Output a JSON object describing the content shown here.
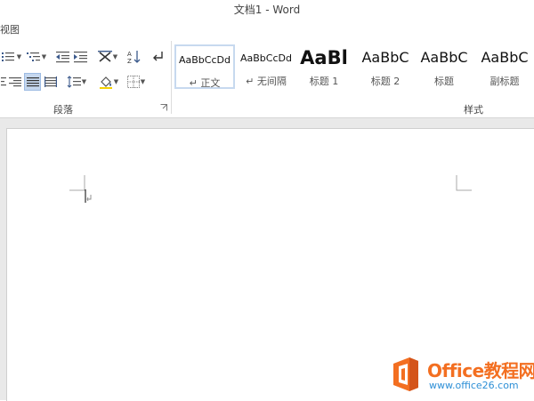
{
  "window": {
    "title": "文档1 - Word"
  },
  "tabs": {
    "view_partial": "视图"
  },
  "ribbon": {
    "paragraph_group_label": "段落",
    "styles_group_label": "样式",
    "styles": [
      {
        "preview": "AaBbCcDd",
        "name": "↵ 正文",
        "selected": true
      },
      {
        "preview": "AaBbCcDd",
        "name": "↵ 无间隔",
        "selected": false
      },
      {
        "preview": "AaBl",
        "name": "标题 1",
        "selected": false
      },
      {
        "preview": "AaBbC",
        "name": "标题 2",
        "selected": false
      },
      {
        "preview": "AaBbC",
        "name": "标题",
        "selected": false
      },
      {
        "preview": "AaBbC",
        "name": "副标题",
        "selected": false
      }
    ]
  },
  "watermark": {
    "brand_latin": "Office",
    "brand_cn": "教程网",
    "url": "www.office26.com",
    "colors": {
      "orange": "#f36f21",
      "blue": "#2d8fd6"
    }
  },
  "colors": {
    "accent_selected": "#c5d7ee",
    "doc_bg": "#e9e9e9"
  }
}
